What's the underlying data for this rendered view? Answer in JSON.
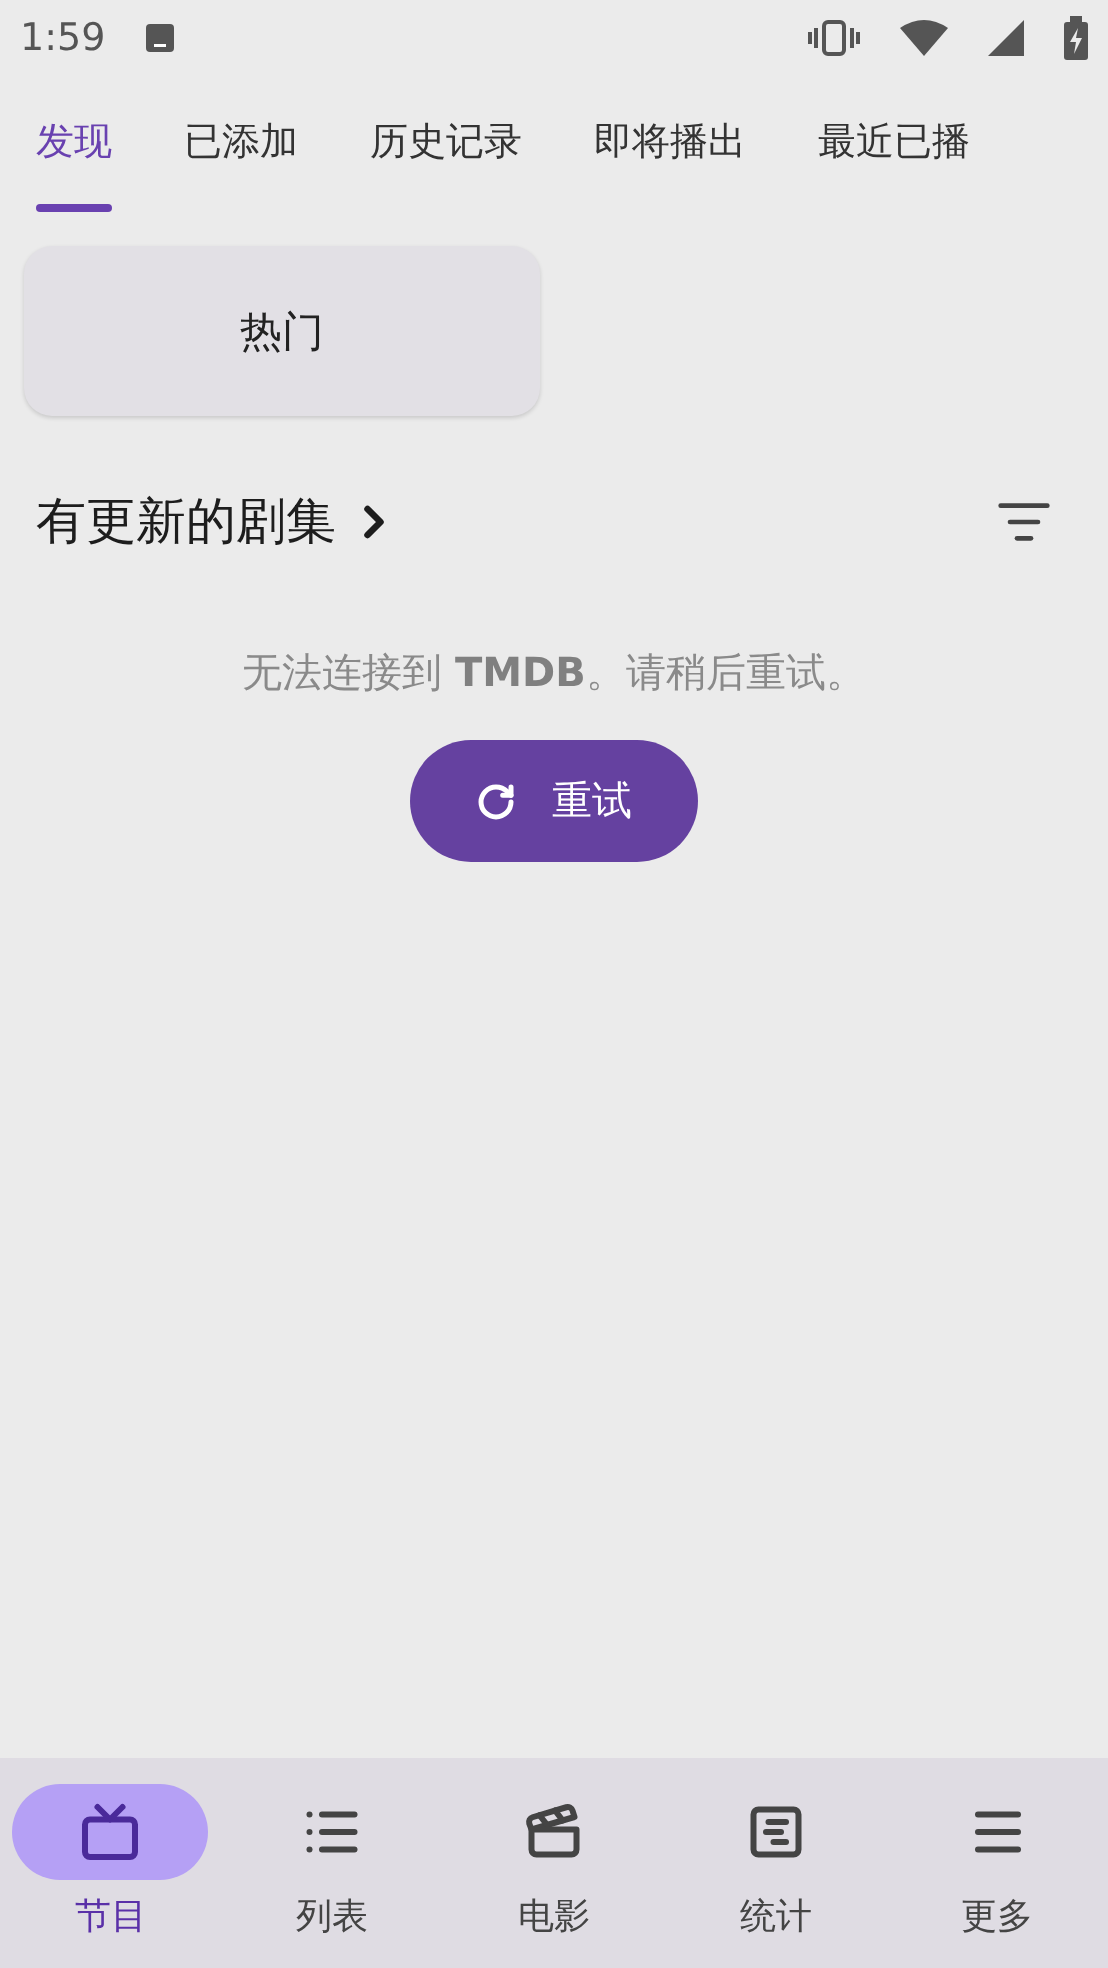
{
  "status_bar": {
    "time": "1:59"
  },
  "tabs": [
    {
      "label": "发现",
      "selected": true
    },
    {
      "label": "已添加",
      "selected": false
    },
    {
      "label": "历史记录",
      "selected": false
    },
    {
      "label": "即将播出",
      "selected": false
    },
    {
      "label": "最近已播",
      "selected": false
    }
  ],
  "chips": [
    {
      "label": "热门"
    }
  ],
  "section": {
    "title": "有更新的剧集"
  },
  "error": {
    "message": "无法连接到 **TMDB**。请稍后重试。",
    "retry_button": "重试"
  },
  "bottom_nav": [
    {
      "kind": "tv",
      "label": "节目",
      "selected": true
    },
    {
      "kind": "list",
      "label": "列表",
      "selected": false
    },
    {
      "kind": "movie",
      "label": "电影",
      "selected": false
    },
    {
      "kind": "stats",
      "label": "统计",
      "selected": false
    },
    {
      "kind": "more",
      "label": "更多",
      "selected": false
    }
  ]
}
